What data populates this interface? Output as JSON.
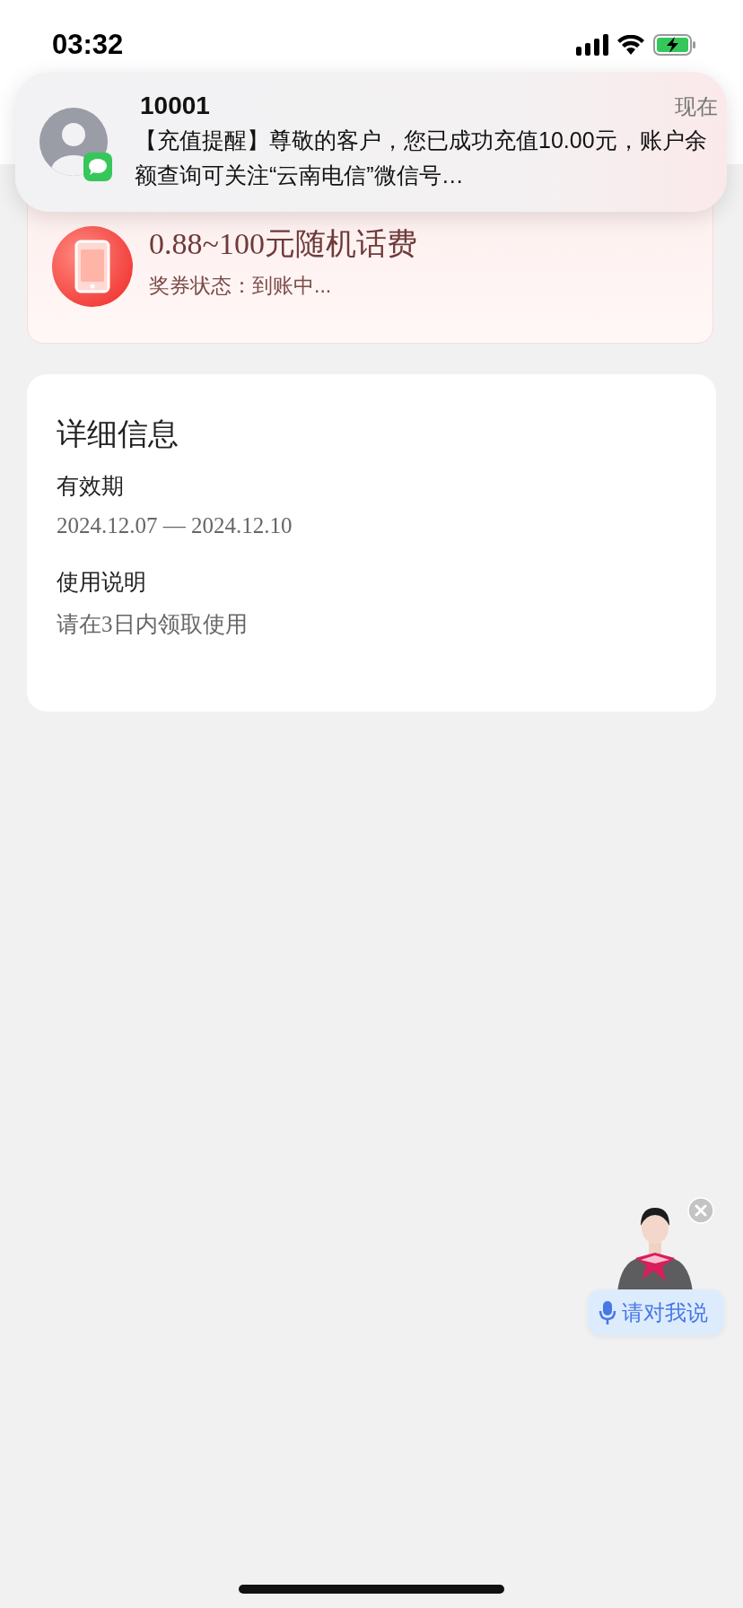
{
  "status_bar": {
    "time": "03:32"
  },
  "notification": {
    "sender": "10001",
    "time": "现在",
    "message": "【充值提醒】尊敬的客户，您已成功充值10.00元，账户余额查询可关注“云南电信”微信号…"
  },
  "voucher": {
    "title": "0.88~100元随机话费",
    "status": "奖券状态：到账中..."
  },
  "details": {
    "title": "详细信息",
    "sections": [
      {
        "label": "有效期",
        "value": "2024.12.07 — 2024.12.10"
      },
      {
        "label": "使用说明",
        "value": "请在3日内领取使用"
      }
    ]
  },
  "assistant": {
    "button_label": "请对我说"
  }
}
